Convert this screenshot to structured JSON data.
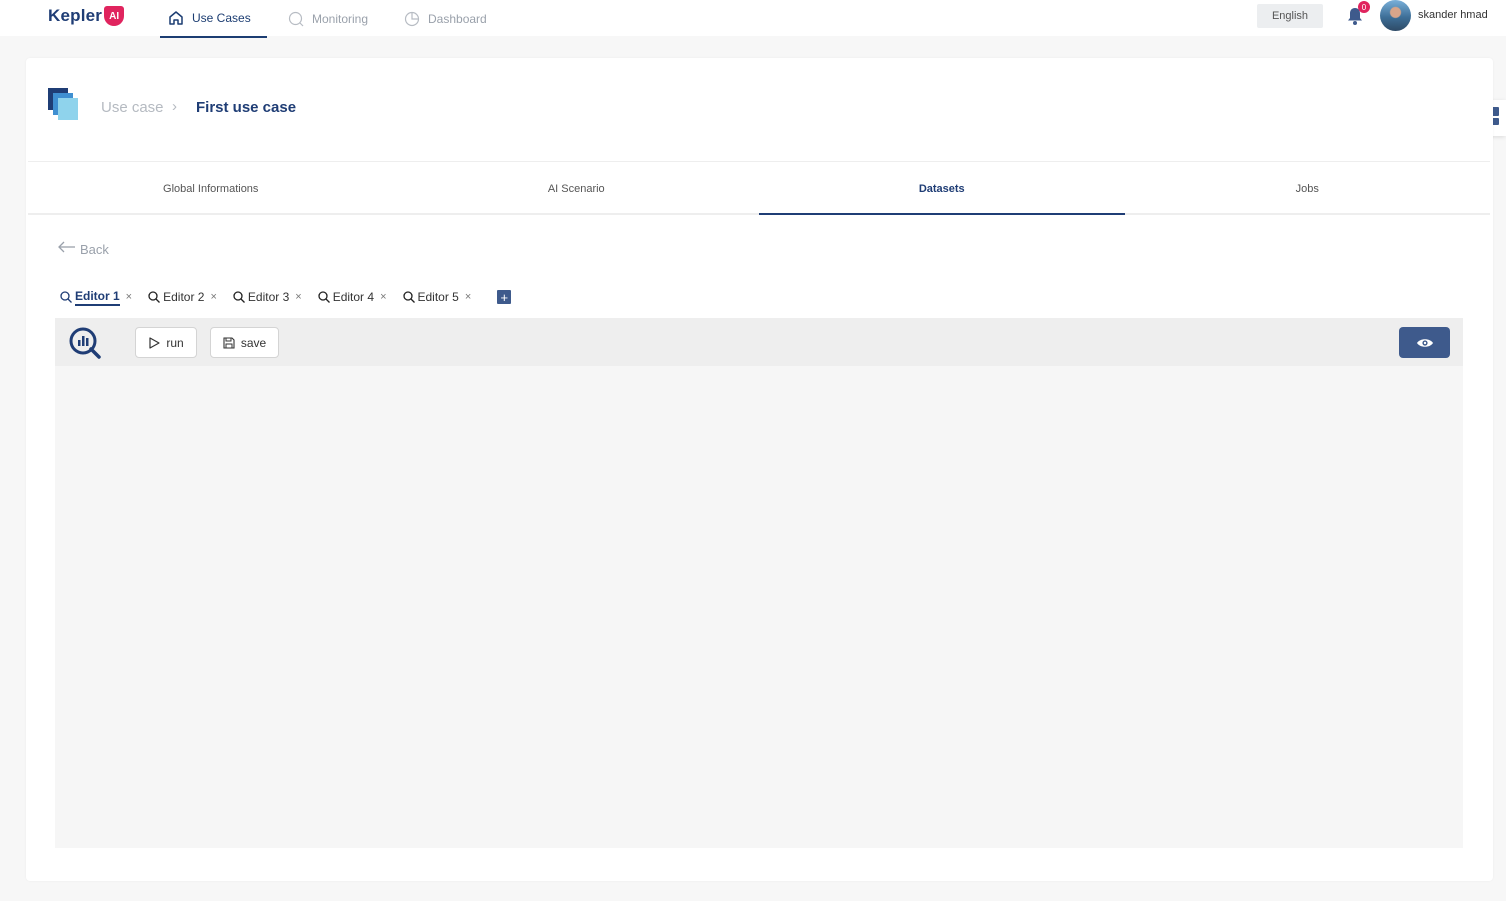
{
  "app": {
    "logo_text": "Kepler",
    "logo_badge": "AI"
  },
  "nav": {
    "items": [
      {
        "label": "Use Cases",
        "icon": "home-icon",
        "active": true
      },
      {
        "label": "Monitoring",
        "icon": "search-icon",
        "active": false
      },
      {
        "label": "Dashboard",
        "icon": "pie-chart-icon",
        "active": false
      }
    ]
  },
  "header": {
    "language": "English",
    "notification_count": "0",
    "user_name": "skander hmad"
  },
  "breadcrumb": {
    "parent": "Use case",
    "separator": "›",
    "current": "First use case"
  },
  "tabs": [
    {
      "label": "Global Informations",
      "active": false
    },
    {
      "label": "AI Scenario",
      "active": false
    },
    {
      "label": "Datasets",
      "active": true
    },
    {
      "label": "Jobs",
      "active": false
    }
  ],
  "back_label": "Back",
  "editor_tabs": [
    {
      "label": "Editor 1",
      "active": true
    },
    {
      "label": "Editor 2",
      "active": false
    },
    {
      "label": "Editor 3",
      "active": false
    },
    {
      "label": "Editor 4",
      "active": false
    },
    {
      "label": "Editor 5",
      "active": false
    }
  ],
  "editor_tabs_close": "×",
  "add_tab_label": "+",
  "toolbar": {
    "run_label": "run",
    "save_label": "save"
  },
  "colors": {
    "primary": "#1f3d75",
    "accent": "#e0245e",
    "button": "#3e5a8c"
  }
}
